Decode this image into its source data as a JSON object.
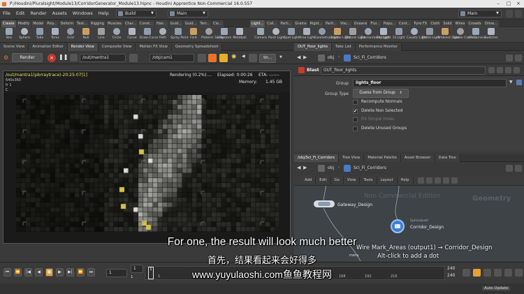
{
  "window": {
    "title": "P:/Houdini/Pluralsight/Module13/CorridorGenerator_Module13.hipnc - Houdini Apprentice Non-Commercial 16.0.557"
  },
  "menu": {
    "items": [
      "File",
      "Edit",
      "Render",
      "Assets",
      "Windows",
      "Help"
    ],
    "desktop_left": "Build",
    "desktop_mid": "Main",
    "desktop_right": "Main"
  },
  "shelf_left": {
    "tabs": [
      "Create",
      "Modify",
      "Model",
      "Poly...",
      "Deform",
      "Text...",
      "Rigging",
      "Muscles",
      "Char...",
      "Const...",
      "Hair...",
      "Guid...",
      "Guid...",
      "Terr...",
      "Clo..."
    ],
    "tools": [
      "Box",
      "Sphere",
      "Tube",
      "Torus",
      "Grid",
      "Null",
      "Line",
      "Circle",
      "Curve",
      "Draw Curve",
      "Path",
      "Spray Paint",
      "Font",
      "Platonic Solids",
      "L-System",
      "Metaball",
      "File"
    ]
  },
  "shelf_right": {
    "tabs": [
      "Light...",
      "Coll...",
      "Parti...",
      "Grains",
      "Rigid...",
      "Parti...",
      "Visc...",
      "Oceans",
      "Flui...",
      "Popu...",
      "Cont...",
      "Pyro FX",
      "Cloth",
      "Solid",
      "Wires",
      "Crowds",
      "Drive..."
    ],
    "tools": [
      "Camera",
      "Point Light",
      "Spot Light",
      "Area Light",
      "Geometry Light",
      "Volume Light",
      "Distant Light",
      "Environment Light",
      "Sky Light",
      "GI Light",
      "Caustic Light",
      "Portal Light",
      "Ambient Light",
      "Stereo Camera",
      "VR Camera",
      "Switcher"
    ]
  },
  "left_pane": {
    "tabs": [
      "Scene View",
      "Animation Editor",
      "Render View",
      "Composite View",
      "Motion FX View",
      "Geometry Spreadsheet"
    ],
    "render_button": "Render",
    "rop_path": "/out/mantra1",
    "cam_path": "/obj/cam1",
    "snapshot": "Sh..."
  },
  "render_view": {
    "path": "/out/mantra1(pbrraytrace)-20:25:07[1]",
    "resolution": "640x360",
    "frame": "fr 1",
    "channel": "C",
    "status": "Rendering (0.2%)....",
    "elapsed": "Elapsed: 0:00:26",
    "eta": "ETA: -:--:--",
    "memory_label": "Memory:",
    "memory": "1.45 GB"
  },
  "param_pane": {
    "tabs": [
      "OUT_floor_lights",
      "Take List",
      "Performance Monitor"
    ],
    "context": "obj",
    "network": "Sci_Fi_Corridors",
    "node_type": "Blast",
    "node_name": "OUT_floor_lights",
    "group_label": "Group",
    "group_value": "lights_floor",
    "group_type_label": "Group Type",
    "group_type_value": "Guess from Group",
    "checks": [
      {
        "label": "Recompute Normals",
        "checked": false,
        "enabled": true
      },
      {
        "label": "Delete Non Selected",
        "checked": true,
        "enabled": true
      },
      {
        "label": "Fill Simple Holes",
        "checked": false,
        "enabled": false
      },
      {
        "label": "Delete Unused Groups",
        "checked": false,
        "enabled": true
      }
    ]
  },
  "network_pane": {
    "tabs": [
      "/obj/Sci_Fi_Corridors",
      "Tree View",
      "Material Palette",
      "Asset Browser",
      "Data Tree"
    ],
    "context": "obj",
    "network": "Sci_Fi_Corridors",
    "menu": [
      "Add",
      "Edit",
      "Go",
      "View",
      "Tools",
      "Layout",
      "Help"
    ],
    "watermark": "Non-Commercial Edition",
    "geo_label": "Geometry",
    "nodes": [
      {
        "name": "Gateway_Design"
      },
      {
        "name": "Corridor_Design",
        "label": "Sphinxbush"
      }
    ],
    "hint": "Alt-click to add a dot",
    "wire_label": "Wire Mark_Areas (output1) → Corridor_Design",
    "wire_side": "mera"
  },
  "timeline": {
    "frame_start": "1",
    "frame_current": "1",
    "frame_end": "240",
    "frame_end2": "240",
    "ticks": [
      "1",
      "",
      "",
      "",
      "",
      "",
      "",
      "168",
      "192",
      "216",
      "",
      ""
    ],
    "auto_update": "Auto Update"
  },
  "subtitles": {
    "english": "For one, the result will look much better",
    "chinese": "首先，结果看起来会好得多",
    "url": "www.yuyulaoshi.com鱼鱼教程网"
  },
  "colors": {
    "orange": "#e8722a",
    "yellow": "#e8e060",
    "blast": "#c23d2b",
    "node_blue": "#3f7fd8"
  }
}
